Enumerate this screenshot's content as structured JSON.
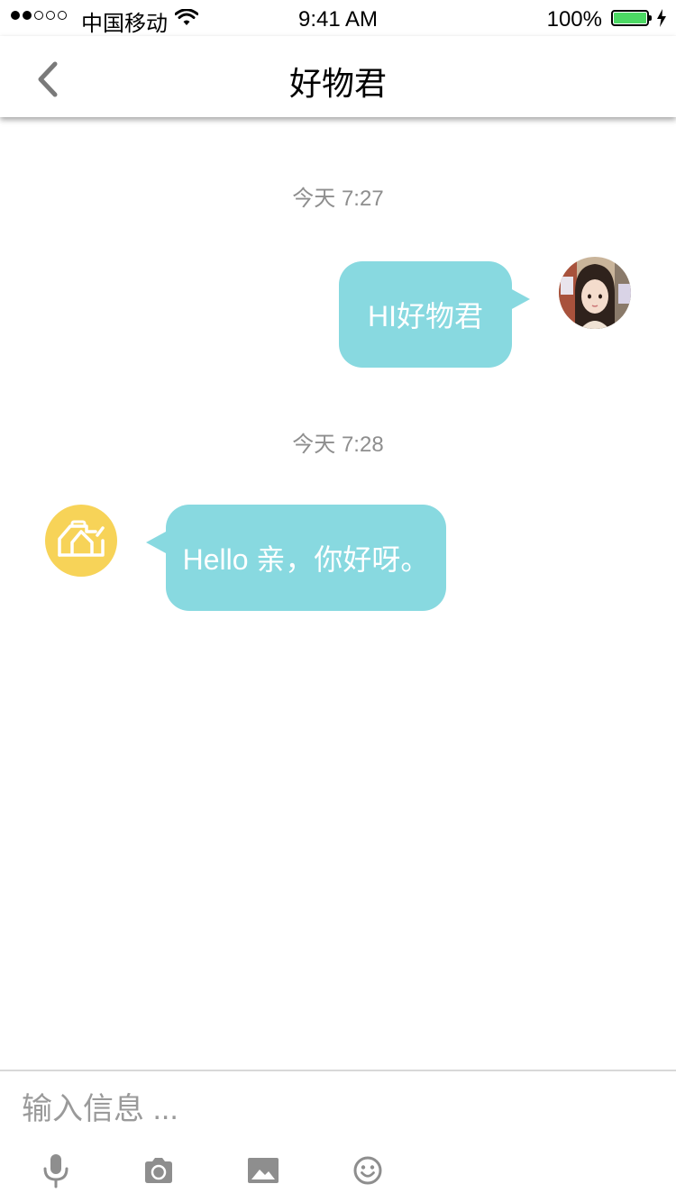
{
  "status_bar": {
    "carrier": "中国移动",
    "time": "9:41 AM",
    "battery_percent": "100%",
    "battery_level": 1.0,
    "signal_bars_filled": 2,
    "signal_bars_total": 5,
    "signal_icon": "signal-dots-icon",
    "wifi_icon": "wifi-icon",
    "charging_icon": "charging-bolt-icon",
    "battery_color": "#4cd964"
  },
  "nav": {
    "back_icon": "chevron-left-icon",
    "title": "好物君"
  },
  "chat": {
    "bubble_color": "#88d9e0",
    "timestamp_color": "#8e8e8e",
    "messages": [
      {
        "timestamp": "今天 7:27",
        "sender": "user",
        "text": "HI好物君",
        "avatar_icon": "user-avatar"
      },
      {
        "timestamp": "今天 7:28",
        "sender": "bot",
        "text": "Hello 亲，你好呀。",
        "avatar_icon": "house-logo-icon",
        "avatar_color": "#f7d358"
      }
    ]
  },
  "input": {
    "placeholder": "输入信息 ...",
    "value": "",
    "tools": [
      {
        "name": "microphone-icon"
      },
      {
        "name": "camera-icon"
      },
      {
        "name": "image-icon"
      },
      {
        "name": "emoji-icon"
      }
    ]
  }
}
